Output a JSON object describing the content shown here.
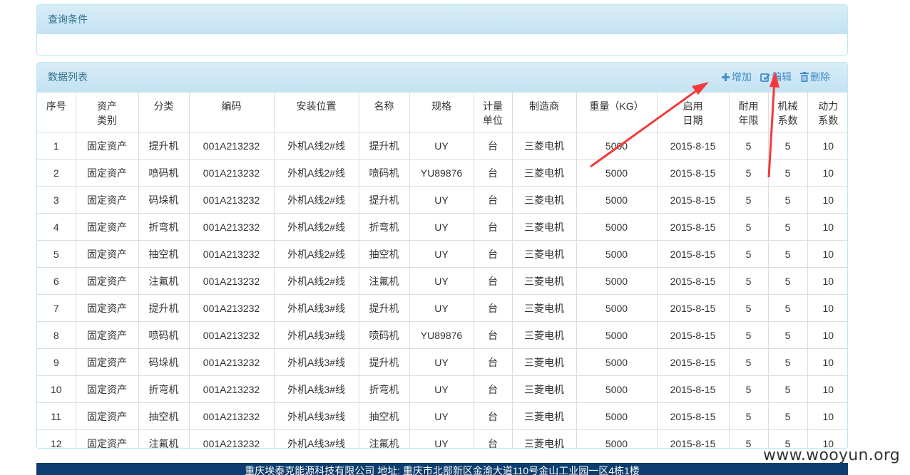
{
  "query_panel": {
    "title": "查询条件"
  },
  "list_panel": {
    "title": "数据列表",
    "toolbar": {
      "add": "增加",
      "edit": "编辑",
      "delete": "删除"
    }
  },
  "table": {
    "headers": [
      [
        "序号"
      ],
      [
        "资产",
        "类别"
      ],
      [
        "分类"
      ],
      [
        "编码"
      ],
      [
        "安装位置"
      ],
      [
        "名称"
      ],
      [
        "规格"
      ],
      [
        "计量",
        "单位"
      ],
      [
        "制造商"
      ],
      [
        "重量（KG）"
      ],
      [
        "启用",
        "日期"
      ],
      [
        "耐用",
        "年限"
      ],
      [
        "机械",
        "系数"
      ],
      [
        "动力",
        "系数"
      ]
    ],
    "rows": [
      [
        "1",
        "固定资产",
        "提升机",
        "001A213232",
        "外机A线2#线",
        "提升机",
        "UY",
        "台",
        "三菱电机",
        "5000",
        "2015-8-15",
        "5",
        "5",
        "10"
      ],
      [
        "2",
        "固定资产",
        "喷码机",
        "001A213232",
        "外机A线2#线",
        "喷码机",
        "YU89876",
        "台",
        "三菱电机",
        "5000",
        "2015-8-15",
        "5",
        "5",
        "10"
      ],
      [
        "3",
        "固定资产",
        "码垛机",
        "001A213232",
        "外机A线2#线",
        "提升机",
        "UY",
        "台",
        "三菱电机",
        "5000",
        "2015-8-15",
        "5",
        "5",
        "10"
      ],
      [
        "4",
        "固定资产",
        "折弯机",
        "001A213232",
        "外机A线2#线",
        "折弯机",
        "UY",
        "台",
        "三菱电机",
        "5000",
        "2015-8-15",
        "5",
        "5",
        "10"
      ],
      [
        "5",
        "固定资产",
        "抽空机",
        "001A213232",
        "外机A线2#线",
        "抽空机",
        "UY",
        "台",
        "三菱电机",
        "5000",
        "2015-8-15",
        "5",
        "5",
        "10"
      ],
      [
        "6",
        "固定资产",
        "注氟机",
        "001A213232",
        "外机A线2#线",
        "注氟机",
        "UY",
        "台",
        "三菱电机",
        "5000",
        "2015-8-15",
        "5",
        "5",
        "10"
      ],
      [
        "7",
        "固定资产",
        "提升机",
        "001A213232",
        "外机A线3#线",
        "提升机",
        "UY",
        "台",
        "三菱电机",
        "5000",
        "2015-8-15",
        "5",
        "5",
        "10"
      ],
      [
        "8",
        "固定资产",
        "喷码机",
        "001A213232",
        "外机A线3#线",
        "喷码机",
        "YU89876",
        "台",
        "三菱电机",
        "5000",
        "2015-8-15",
        "5",
        "5",
        "10"
      ],
      [
        "9",
        "固定资产",
        "码垛机",
        "001A213232",
        "外机A线3#线",
        "提升机",
        "UY",
        "台",
        "三菱电机",
        "5000",
        "2015-8-15",
        "5",
        "5",
        "10"
      ],
      [
        "10",
        "固定资产",
        "折弯机",
        "001A213232",
        "外机A线3#线",
        "折弯机",
        "UY",
        "台",
        "三菱电机",
        "5000",
        "2015-8-15",
        "5",
        "5",
        "10"
      ],
      [
        "11",
        "固定资产",
        "抽空机",
        "001A213232",
        "外机A线3#线",
        "抽空机",
        "UY",
        "台",
        "三菱电机",
        "5000",
        "2015-8-15",
        "5",
        "5",
        "10"
      ],
      [
        "12",
        "固定资产",
        "注氟机",
        "001A213232",
        "外机A线3#线",
        "注氟机",
        "UY",
        "台",
        "三菱电机",
        "5000",
        "2015-8-15",
        "5",
        "5",
        "10"
      ]
    ]
  },
  "footer": {
    "text": "重庆埃泰克能源科技有限公司 地址: 重庆市北部新区金渝大道110号金山工业园一区4栋1楼"
  },
  "watermark": {
    "text": "www.wooyun.org"
  },
  "colors": {
    "panel_header": "#d9edf7",
    "panel_border": "#bce8f1",
    "accent": "#428bca",
    "footer_bg": "#0b3d6e",
    "annotation_arrow": "#f23a3a"
  },
  "icons": {
    "add": "plus-icon",
    "edit": "edit-icon",
    "delete": "trash-icon"
  }
}
